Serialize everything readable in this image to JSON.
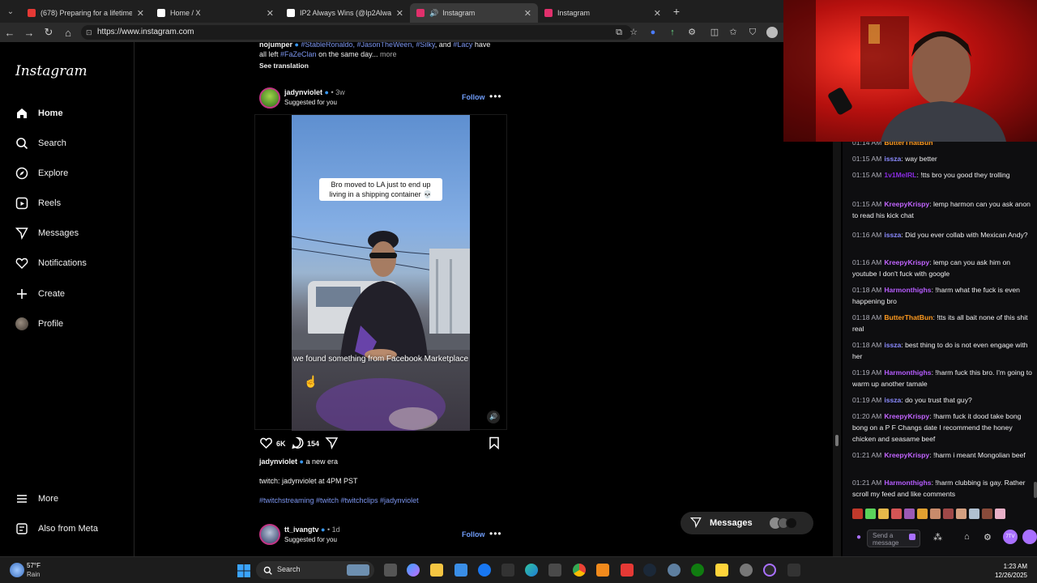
{
  "browser": {
    "tabs": [
      {
        "title": "(678) Preparing for a lifetime of lo",
        "color": "#e53935",
        "active": false
      },
      {
        "title": "Home / X",
        "color": "#ffffff",
        "active": false
      },
      {
        "title": "IP2 Always Wins (@Ip2AlwaysWin",
        "color": "#ffffff",
        "active": false
      },
      {
        "title": "Instagram",
        "color": "#e1306c",
        "active": true
      },
      {
        "title": "Instagram",
        "color": "#e1306c",
        "active": false
      }
    ],
    "url": "https://www.instagram.com"
  },
  "instagram": {
    "logo": "Instagram",
    "nav": [
      {
        "label": "Home",
        "icon": "home-icon",
        "glyph": "⌂"
      },
      {
        "label": "Search",
        "icon": "search-icon",
        "glyph": "⚲"
      },
      {
        "label": "Explore",
        "icon": "explore-icon",
        "glyph": "◎"
      },
      {
        "label": "Reels",
        "icon": "reels-icon",
        "glyph": "▶"
      },
      {
        "label": "Messages",
        "icon": "messages-icon",
        "glyph": "▽"
      },
      {
        "label": "Notifications",
        "icon": "heart-icon",
        "glyph": "♡"
      },
      {
        "label": "Create",
        "icon": "plus-icon",
        "glyph": "+"
      },
      {
        "label": "Profile",
        "icon": "avatar",
        "glyph": ""
      }
    ],
    "more": "More",
    "also_from_meta": "Also from Meta",
    "prev_post": {
      "line1_user": "nojumper",
      "line1_tags": "#StableRonaldo, #JasonTheWeen, #Silky",
      "line1_and": ", and",
      "line1_tag2": "#Lacy",
      "line1_rest": " have",
      "line2_start": "all left",
      "line2_tag": "#FaZeClan",
      "line2_rest": "on the same day...",
      "more": "more",
      "see_translation": "See translation"
    },
    "post": {
      "username": "jadynviolet",
      "time": "3w",
      "suggested": "Suggested for you",
      "follow": "Follow",
      "caption_top": "Bro moved to LA just to end up living in a shipping container 💀",
      "caption_bottom": "we found something from Facebook Marketplace",
      "likes": "6K",
      "comments": "154",
      "caption_user": "jadynviolet",
      "caption_text": "a new era",
      "line2": "twitch: jadynviolet at 4PM PST",
      "hashtags": "#twitchstreaming #twitch #twitchclips #jadynviolet"
    },
    "next_post": {
      "username": "tt_ivangtv",
      "time": "1d",
      "suggested": "Suggested for you",
      "follow": "Follow"
    },
    "messages_pill": "Messages"
  },
  "chat": {
    "messages": [
      {
        "time": "01:14 AM",
        "user": "ButterThatBun",
        "color": "#ff9a1f",
        "text": ""
      },
      {
        "time": "01:15 AM",
        "user": "issza",
        "color": "#8a8aff",
        "text": "way better"
      },
      {
        "time": "01:15 AM",
        "user": "1v1MeIRL",
        "color": "#8a2be2",
        "text": "!tts bro you good they trolling"
      },
      {
        "time": "01:15 AM",
        "user": "KreepyKrispy",
        "color": "#c264ff",
        "text": "lemp harmon can you ask anon to read his kick chat"
      },
      {
        "time": "01:16 AM",
        "user": "issza",
        "color": "#8a8aff",
        "text": "Did you ever collab with Mexican Andy?"
      },
      {
        "time": "01:16 AM",
        "user": "KreepyKrispy",
        "color": "#c264ff",
        "text": "lemp can you ask him on youtube I don't fuck with google"
      },
      {
        "time": "01:18 AM",
        "user": "Harmonthighs",
        "color": "#b65cff",
        "text": "!harm what the fuck is even happening bro"
      },
      {
        "time": "01:18 AM",
        "user": "ButterThatBun",
        "color": "#ff9a1f",
        "text": "!tts its all bait none of this shit real"
      },
      {
        "time": "01:18 AM",
        "user": "issza",
        "color": "#8a8aff",
        "text": "best thing to do is not even engage with her"
      },
      {
        "time": "01:19 AM",
        "user": "Harmonthighs",
        "color": "#b65cff",
        "text": "!harm fuck this bro. I'm going to warm up another tamale"
      },
      {
        "time": "01:19 AM",
        "user": "issza",
        "color": "#8a8aff",
        "text": "do you trust that guy?"
      },
      {
        "time": "01:20 AM",
        "user": "KreepyKrispy",
        "color": "#c264ff",
        "text": "!harm fuck it dood take bong bong on a P F Changs date I recommend the honey chicken and seasame beef"
      },
      {
        "time": "01:21 AM",
        "user": "KreepyKrispy",
        "color": "#c264ff",
        "text": "!harm i meant Mongolian beef"
      },
      {
        "time": "01:21 AM",
        "user": "Harmonthighs",
        "color": "#b65cff",
        "text": "!harm clubbing is gay. Rather scroll my feed and like comments"
      }
    ],
    "input_placeholder": "Send a message"
  },
  "taskbar": {
    "weather_temp": "57°F",
    "weather_desc": "Rain",
    "search": "Search",
    "time": "1:23 AM",
    "date": "12/26/2025"
  }
}
